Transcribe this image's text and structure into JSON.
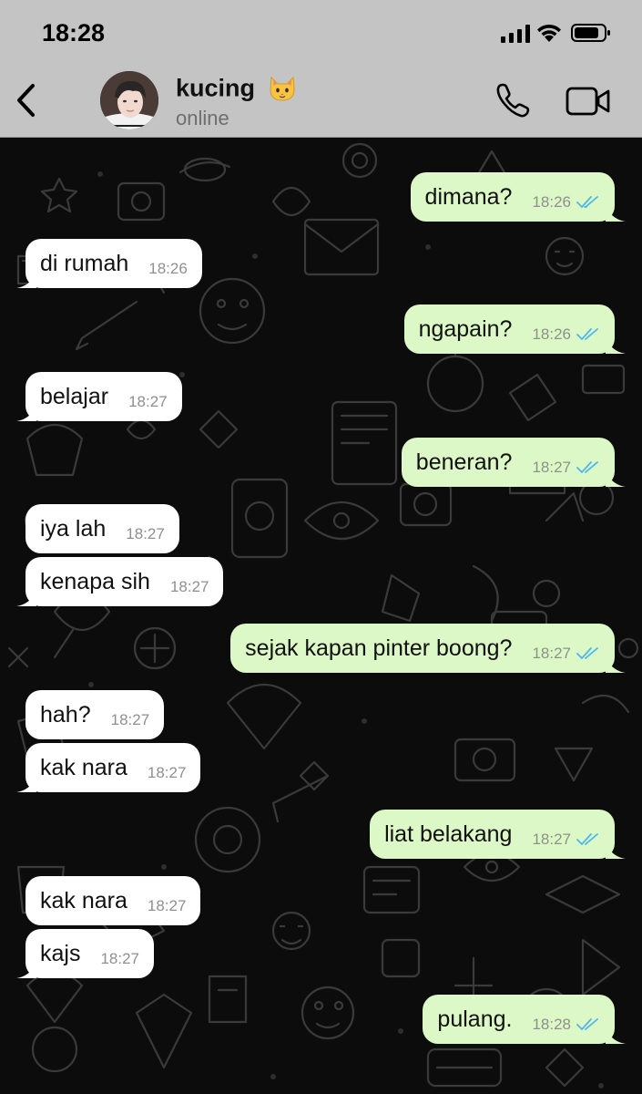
{
  "status_bar": {
    "time": "18:28"
  },
  "header": {
    "contact_name": "kucing",
    "contact_emoji": "cat-face-emoji",
    "contact_status": "online",
    "icons": [
      "back-chevron-icon",
      "phone-icon",
      "video-camera-icon"
    ]
  },
  "colors": {
    "incoming_bubble": "#ffffff",
    "outgoing_bubble": "#dcf8c6",
    "read_ticks": "#4fb6ec",
    "header_bg": "#c4c4c4"
  },
  "messages": [
    {
      "direction": "out",
      "text": "dimana?",
      "time": "18:26",
      "read": true
    },
    {
      "direction": "in",
      "text": "di rumah",
      "time": "18:26"
    },
    {
      "direction": "out",
      "text": "ngapain?",
      "time": "18:26",
      "read": true
    },
    {
      "direction": "in",
      "text": "belajar",
      "time": "18:27"
    },
    {
      "direction": "out",
      "text": "beneran?",
      "time": "18:27",
      "read": true
    },
    {
      "direction": "in",
      "text": "iya lah",
      "time": "18:27"
    },
    {
      "direction": "in",
      "text": "kenapa sih",
      "time": "18:27"
    },
    {
      "direction": "out",
      "text": "sejak kapan pinter boong?",
      "time": "18:27",
      "read": true
    },
    {
      "direction": "in",
      "text": "hah?",
      "time": "18:27"
    },
    {
      "direction": "in",
      "text": "kak nara",
      "time": "18:27"
    },
    {
      "direction": "out",
      "text": "liat belakang",
      "time": "18:27",
      "read": true
    },
    {
      "direction": "in",
      "text": "kak nara",
      "time": "18:27"
    },
    {
      "direction": "in",
      "text": "kajs",
      "time": "18:27"
    },
    {
      "direction": "out",
      "text": "pulang.",
      "time": "18:28",
      "read": true
    }
  ]
}
